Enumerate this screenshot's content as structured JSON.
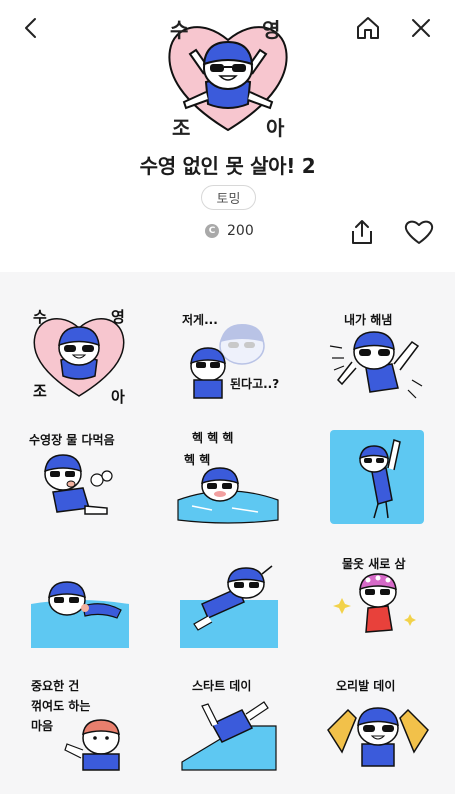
{
  "header": {
    "back_icon": "chevron-left-icon",
    "home_icon": "home-icon",
    "close_icon": "close-icon"
  },
  "pack": {
    "title": "수영 없인 못 살아! 2",
    "author": "토밍",
    "coin_symbol": "C",
    "price": "200",
    "hero_letters": [
      "수",
      "영",
      "조",
      "아"
    ]
  },
  "actions": {
    "share_icon": "share-icon",
    "like_icon": "heart-icon"
  },
  "stickers": [
    {
      "caption": "",
      "letters": [
        "수",
        "영",
        "조",
        "아"
      ]
    },
    {
      "caption": "저게...",
      "caption2": "된다고..?"
    },
    {
      "caption": "내가 해냄"
    },
    {
      "caption": "수영장 물 다먹음"
    },
    {
      "caption": "헥 헥 헥",
      "caption2": "헥 헥"
    },
    {
      "caption": ""
    },
    {
      "caption": ""
    },
    {
      "caption": ""
    },
    {
      "caption": "물옷 새로 삼"
    },
    {
      "caption": "중요한 건",
      "caption2": "꺾여도 하는",
      "caption3": "마음"
    },
    {
      "caption": "스타트 데이"
    },
    {
      "caption": "오리발 데이"
    }
  ],
  "colors": {
    "accent_blue": "#3b5bdb",
    "heart_pink": "#f7c6cf",
    "pool_blue": "#5ec8f2",
    "grid_bg": "#f6f6f7"
  }
}
